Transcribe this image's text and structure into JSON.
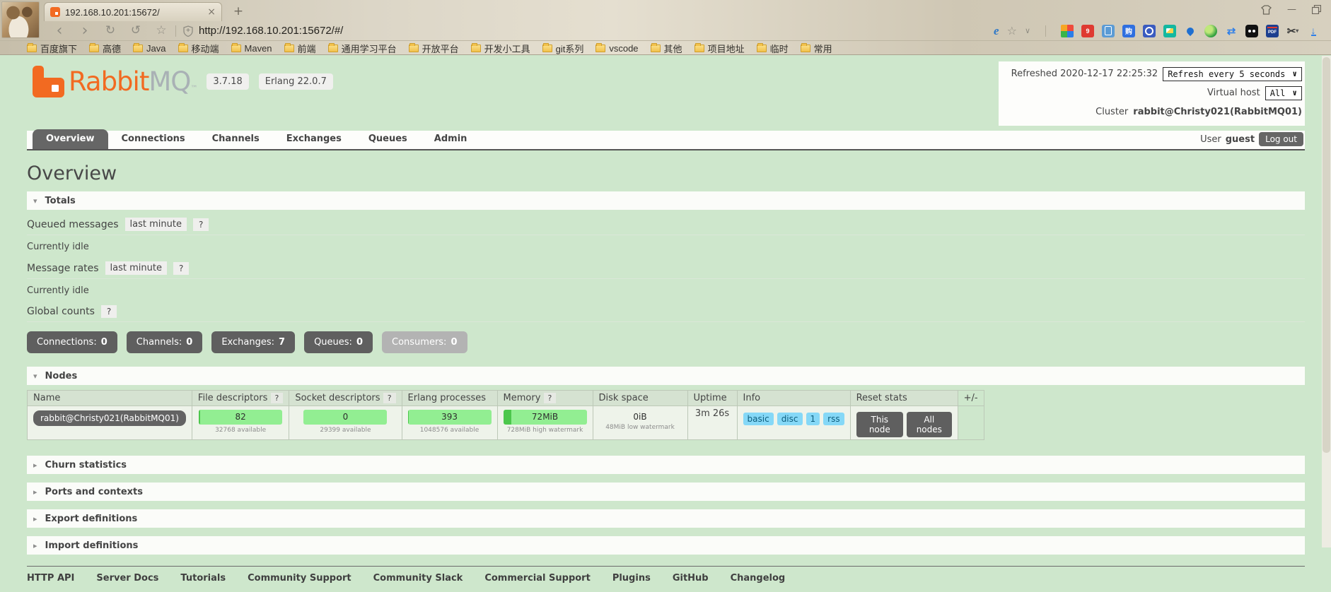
{
  "browser": {
    "tab_title": "192.168.10.201:15672/",
    "tab_close": "×",
    "new_tab": "+",
    "url": "http://192.168.10.201:15672/#/",
    "nav": {
      "back": "‹",
      "forward": "›",
      "refresh": "↻",
      "restore_session": "↺",
      "star": "☆"
    },
    "toolbar": {
      "ie_label": "e",
      "star": "☆",
      "caret": "∨",
      "shop_glyph": "购",
      "pdf_label": "PDF",
      "scissors": "✂",
      "mini_caret": "▾"
    },
    "window_controls": {
      "minimize": "—"
    },
    "bookmarks": [
      "百度旗下",
      "高德",
      "Java",
      "移动端",
      "Maven",
      "前端",
      "通用学习平台",
      "开放平台",
      "开发小工具",
      "git系列",
      "vscode",
      "其他",
      "项目地址",
      "临时",
      "常用"
    ]
  },
  "header": {
    "logo_rabbit": "Rabbit",
    "logo_mq": "MQ",
    "logo_tm": "™",
    "version_badge": "3.7.18",
    "erlang_badge": "Erlang 22.0.7",
    "refreshed_label": "Refreshed 2020-12-17 22:25:32",
    "refresh_select_value": "Refresh every 5 seconds",
    "virtual_host_label": "Virtual host",
    "virtual_host_value": "All",
    "cluster_label": "Cluster",
    "cluster_value": "rabbit@Christy021(RabbitMQ01)",
    "user_label": "User",
    "user_value": "guest",
    "logout_button": "Log out",
    "select_caret": "∨"
  },
  "tabs": [
    {
      "label": "Overview"
    },
    {
      "label": "Connections"
    },
    {
      "label": "Channels"
    },
    {
      "label": "Exchanges"
    },
    {
      "label": "Queues"
    },
    {
      "label": "Admin"
    }
  ],
  "overview": {
    "page_title": "Overview",
    "help_glyph": "?",
    "totals": {
      "section_label": "Totals",
      "queued_label": "Queued messages",
      "queued_range": "last minute",
      "idle1": "Currently idle",
      "rates_label": "Message rates",
      "rates_range": "last minute",
      "idle2": "Currently idle",
      "global_label": "Global counts"
    },
    "counts": [
      {
        "label": "Connections:",
        "value": "0"
      },
      {
        "label": "Channels:",
        "value": "0"
      },
      {
        "label": "Exchanges:",
        "value": "7"
      },
      {
        "label": "Queues:",
        "value": "0"
      },
      {
        "label": "Consumers:",
        "value": "0"
      }
    ],
    "nodes": {
      "section_label": "Nodes",
      "columns": {
        "name": "Name",
        "fd": "File descriptors",
        "sd": "Socket descriptors",
        "erlang": "Erlang processes",
        "memory": "Memory",
        "disk": "Disk space",
        "uptime": "Uptime",
        "info": "Info",
        "reset": "Reset stats",
        "plusminus": "+/-"
      },
      "row": {
        "name": "rabbit@Christy021(RabbitMQ01)",
        "fd_value": "82",
        "fd_sub": "32768 available",
        "sd_value": "0",
        "sd_sub": "29399 available",
        "erlang_value": "393",
        "erlang_sub": "1048576 available",
        "memory_value": "72MiB",
        "memory_sub": "728MiB high watermark",
        "disk_value": "0iB",
        "disk_sub": "48MiB low watermark",
        "uptime": "3m 26s",
        "info_badges": [
          "basic",
          "disc",
          "1",
          "rss"
        ],
        "reset_this": "This node",
        "reset_all": "All nodes"
      }
    },
    "collapsed_sections": [
      "Churn statistics",
      "Ports and contexts",
      "Export definitions",
      "Import definitions"
    ],
    "footer_links": [
      "HTTP API",
      "Server Docs",
      "Tutorials",
      "Community Support",
      "Community Slack",
      "Commercial Support",
      "Plugins",
      "GitHub",
      "Changelog"
    ]
  }
}
